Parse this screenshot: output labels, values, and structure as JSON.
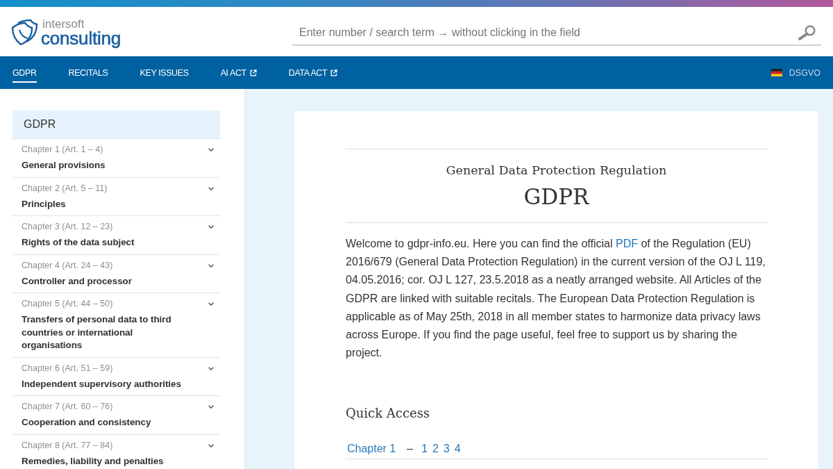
{
  "brand": {
    "line1": "intersoft",
    "line2": "consulting"
  },
  "search": {
    "placeholder": "Enter number / search term → without clicking in the field"
  },
  "nav": {
    "items": [
      {
        "label": "GDPR",
        "selected": true,
        "external": false
      },
      {
        "label": "RECITALS",
        "selected": false,
        "external": false
      },
      {
        "label": "KEY ISSUES",
        "selected": false,
        "external": false
      },
      {
        "label": "AI ACT",
        "selected": false,
        "external": true
      },
      {
        "label": "DATA ACT",
        "selected": false,
        "external": true
      }
    ],
    "language": {
      "label": "DSGVO"
    }
  },
  "sidebar": {
    "title": "GDPR",
    "chapters": [
      {
        "chapter": "Chapter 1 (Art. 1 – 4)",
        "title": "General provisions",
        "expanded": false
      },
      {
        "chapter": "Chapter 2 (Art. 5 – 11)",
        "title": "Principles",
        "expanded": false
      },
      {
        "chapter": "Chapter 3 (Art. 12 – 23)",
        "title": "Rights of the data subject",
        "expanded": false
      },
      {
        "chapter": "Chapter 4 (Art. 24 – 43)",
        "title": "Controller and processor",
        "expanded": false
      },
      {
        "chapter": "Chapter 5 (Art. 44 – 50)",
        "title": "Transfers of personal data to third countries or international organisations",
        "expanded": false
      },
      {
        "chapter": "Chapter 6 (Art. 51 – 59)",
        "title": "Independent supervisory authorities",
        "expanded": false
      },
      {
        "chapter": "Chapter 7 (Art. 60 – 76)",
        "title": "Cooperation and consistency",
        "expanded": false
      },
      {
        "chapter": "Chapter 8 (Art. 77 – 84)",
        "title": "Remedies, liability and penalties",
        "expanded": false
      }
    ]
  },
  "article": {
    "subtitle": "General Data Protection Regulation",
    "title": "GDPR",
    "intro": [
      {
        "kind": "text",
        "text": "Welcome to gdpr-info.eu. Here you can find the official "
      },
      {
        "kind": "link",
        "text": "PDF"
      },
      {
        "kind": "text",
        "text": " of the Regulation (EU) 2016/679 (General Data Protection Regulation) in the current version of the OJ L 119, 04.05.2016; cor. OJ L 127, 23.5.2018 as a neatly arranged website. All Articles of the GDPR are linked with suitable recitals. The European Data Protection Regulation is applicable as of May 25th, 2018 in all member states to harmonize data privacy laws across Europe. If you find the page useful, feel free to support us by sharing the project."
      }
    ],
    "quick_access": {
      "heading": "Quick Access",
      "rows": [
        {
          "chapter": "Chapter 1",
          "separator": "–",
          "articles": [
            "1",
            "2",
            "3",
            "4"
          ]
        }
      ]
    }
  }
}
